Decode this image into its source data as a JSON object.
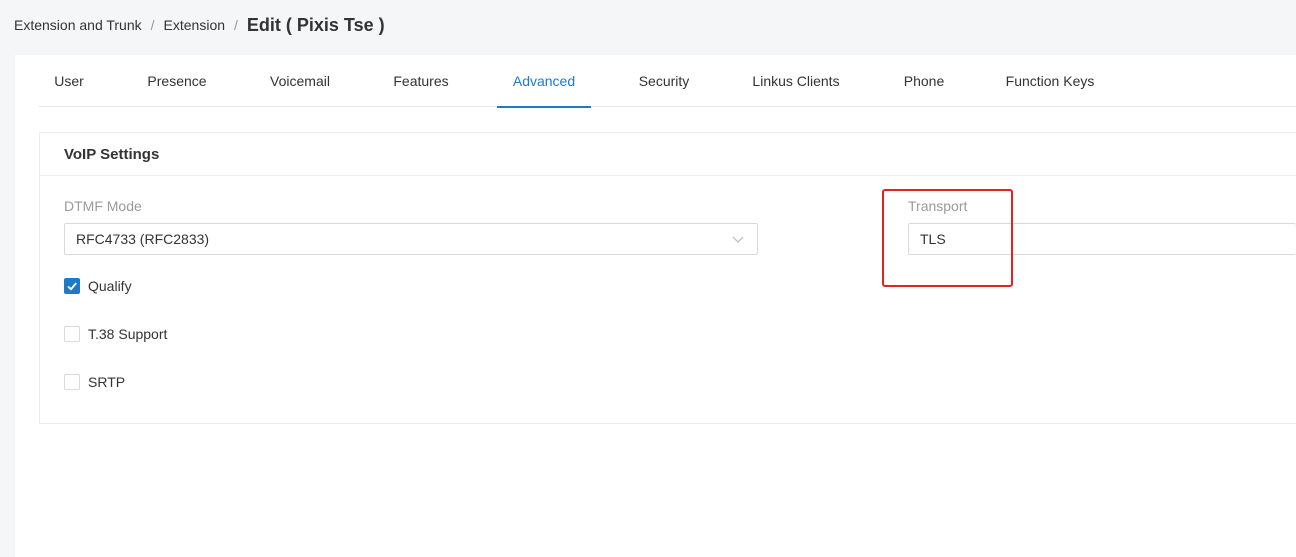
{
  "breadcrumb": {
    "items": [
      "Extension and Trunk",
      "Extension"
    ],
    "separator": "/",
    "current": "Edit ( Pixis Tse )"
  },
  "tabs": [
    {
      "label": "User"
    },
    {
      "label": "Presence"
    },
    {
      "label": "Voicemail"
    },
    {
      "label": "Features"
    },
    {
      "label": "Advanced",
      "active": true
    },
    {
      "label": "Security"
    },
    {
      "label": "Linkus Clients"
    },
    {
      "label": "Phone"
    },
    {
      "label": "Function Keys"
    }
  ],
  "voip": {
    "title": "VoIP Settings",
    "dtmf": {
      "label": "DTMF Mode",
      "value": "RFC4733 (RFC2833)",
      "icon": "chevron-down-icon"
    },
    "transport": {
      "label": "Transport",
      "value": "TLS"
    },
    "checkboxes": [
      {
        "label": "Qualify",
        "checked": true
      },
      {
        "label": "T.38 Support",
        "checked": false
      },
      {
        "label": "SRTP",
        "checked": false
      }
    ]
  },
  "colors": {
    "accent": "#1e7ac7",
    "highlight": "#e02424",
    "background": "#f5f6f8"
  }
}
